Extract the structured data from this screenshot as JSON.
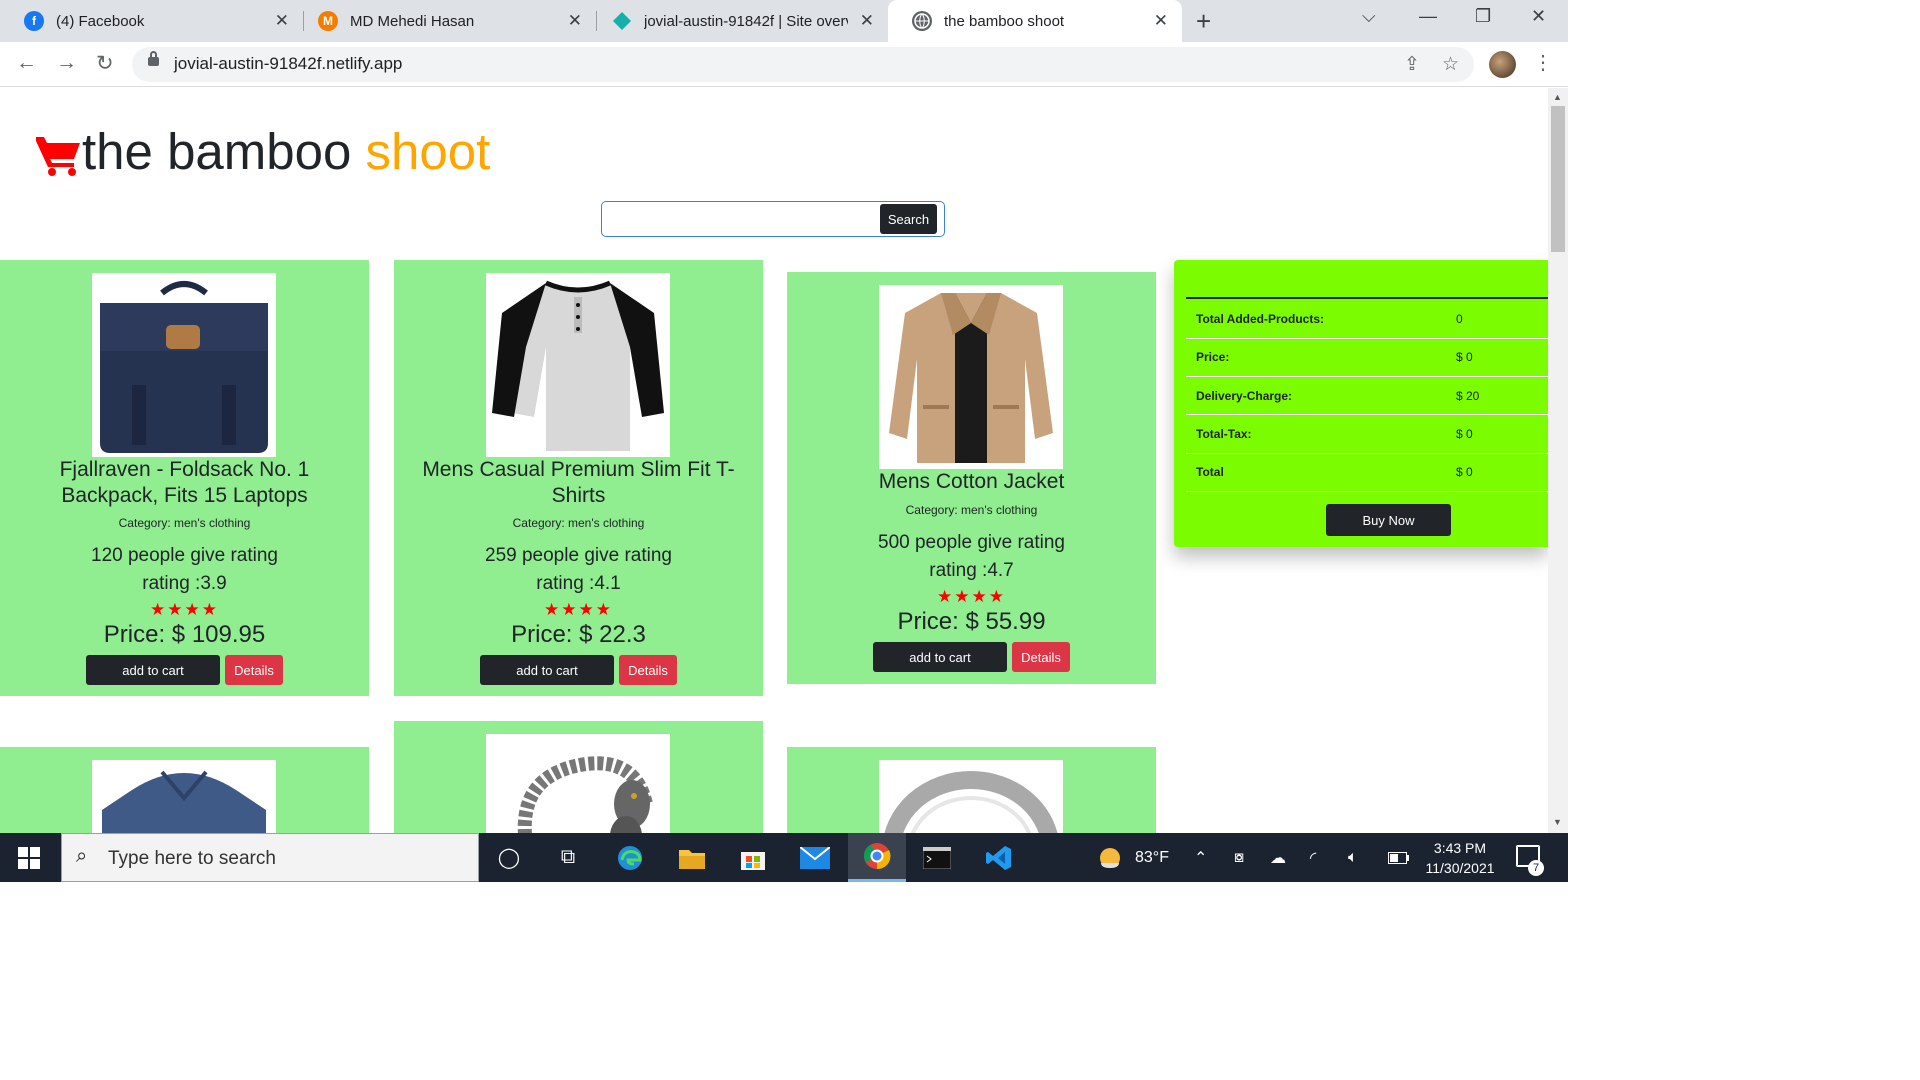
{
  "browser": {
    "tabs": [
      {
        "title": "(4) Facebook",
        "icon": "facebook-icon"
      },
      {
        "title": "MD Mehedi Hasan",
        "icon": "m-logo-icon"
      },
      {
        "title": "jovial-austin-91842f | Site overview",
        "icon": "netlify-icon"
      },
      {
        "title": "the bamboo shoot",
        "icon": "globe-icon"
      }
    ],
    "url": "jovial-austin-91842f.netlify.app"
  },
  "site": {
    "brand_main": "the bamboo ",
    "brand_accent": "shoot",
    "search_placeholder": "",
    "search_button": "Search",
    "accent_color": "#ffa500",
    "card_color": "#90ee90",
    "cart_color": "#7cfc00"
  },
  "products": [
    {
      "name": "Fjallraven - Foldsack No. 1 Backpack, Fits 15 Laptops",
      "category": "Category: men's clothing",
      "count": "120 people give rating",
      "rating": "rating :3.9",
      "stars": "★★★★",
      "price": "Price: $ 109.95",
      "cart_label": "add to cart",
      "details_label": "Details"
    },
    {
      "name": "Mens Casual Premium Slim Fit T-Shirts",
      "category": "Category: men's clothing",
      "count": "259 people give rating",
      "rating": "rating :4.1",
      "stars": "★★★★",
      "price": "Price: $ 22.3",
      "cart_label": "add to cart",
      "details_label": "Details"
    },
    {
      "name": "Mens Cotton Jacket",
      "category": "Category: men's clothing",
      "count": "500 people give rating",
      "rating": "rating :4.7",
      "stars": "★★★★",
      "price": "Price: $ 55.99",
      "cart_label": "add to cart",
      "details_label": "Details"
    }
  ],
  "cart": {
    "rows": [
      {
        "label": "Total Added-Products:",
        "value": "0"
      },
      {
        "label": "Price:",
        "value": "$ 0"
      },
      {
        "label": "Delivery-Charge:",
        "value": "$ 20"
      },
      {
        "label": "Total-Tax:",
        "value": "$ 0"
      },
      {
        "label": "Total",
        "value": "$ 0"
      }
    ],
    "buy_label": "Buy Now"
  },
  "taskbar": {
    "search_placeholder": "Type here to search",
    "temperature": "83°F",
    "time": "3:43 PM",
    "date": "11/30/2021",
    "notification_count": "7"
  }
}
